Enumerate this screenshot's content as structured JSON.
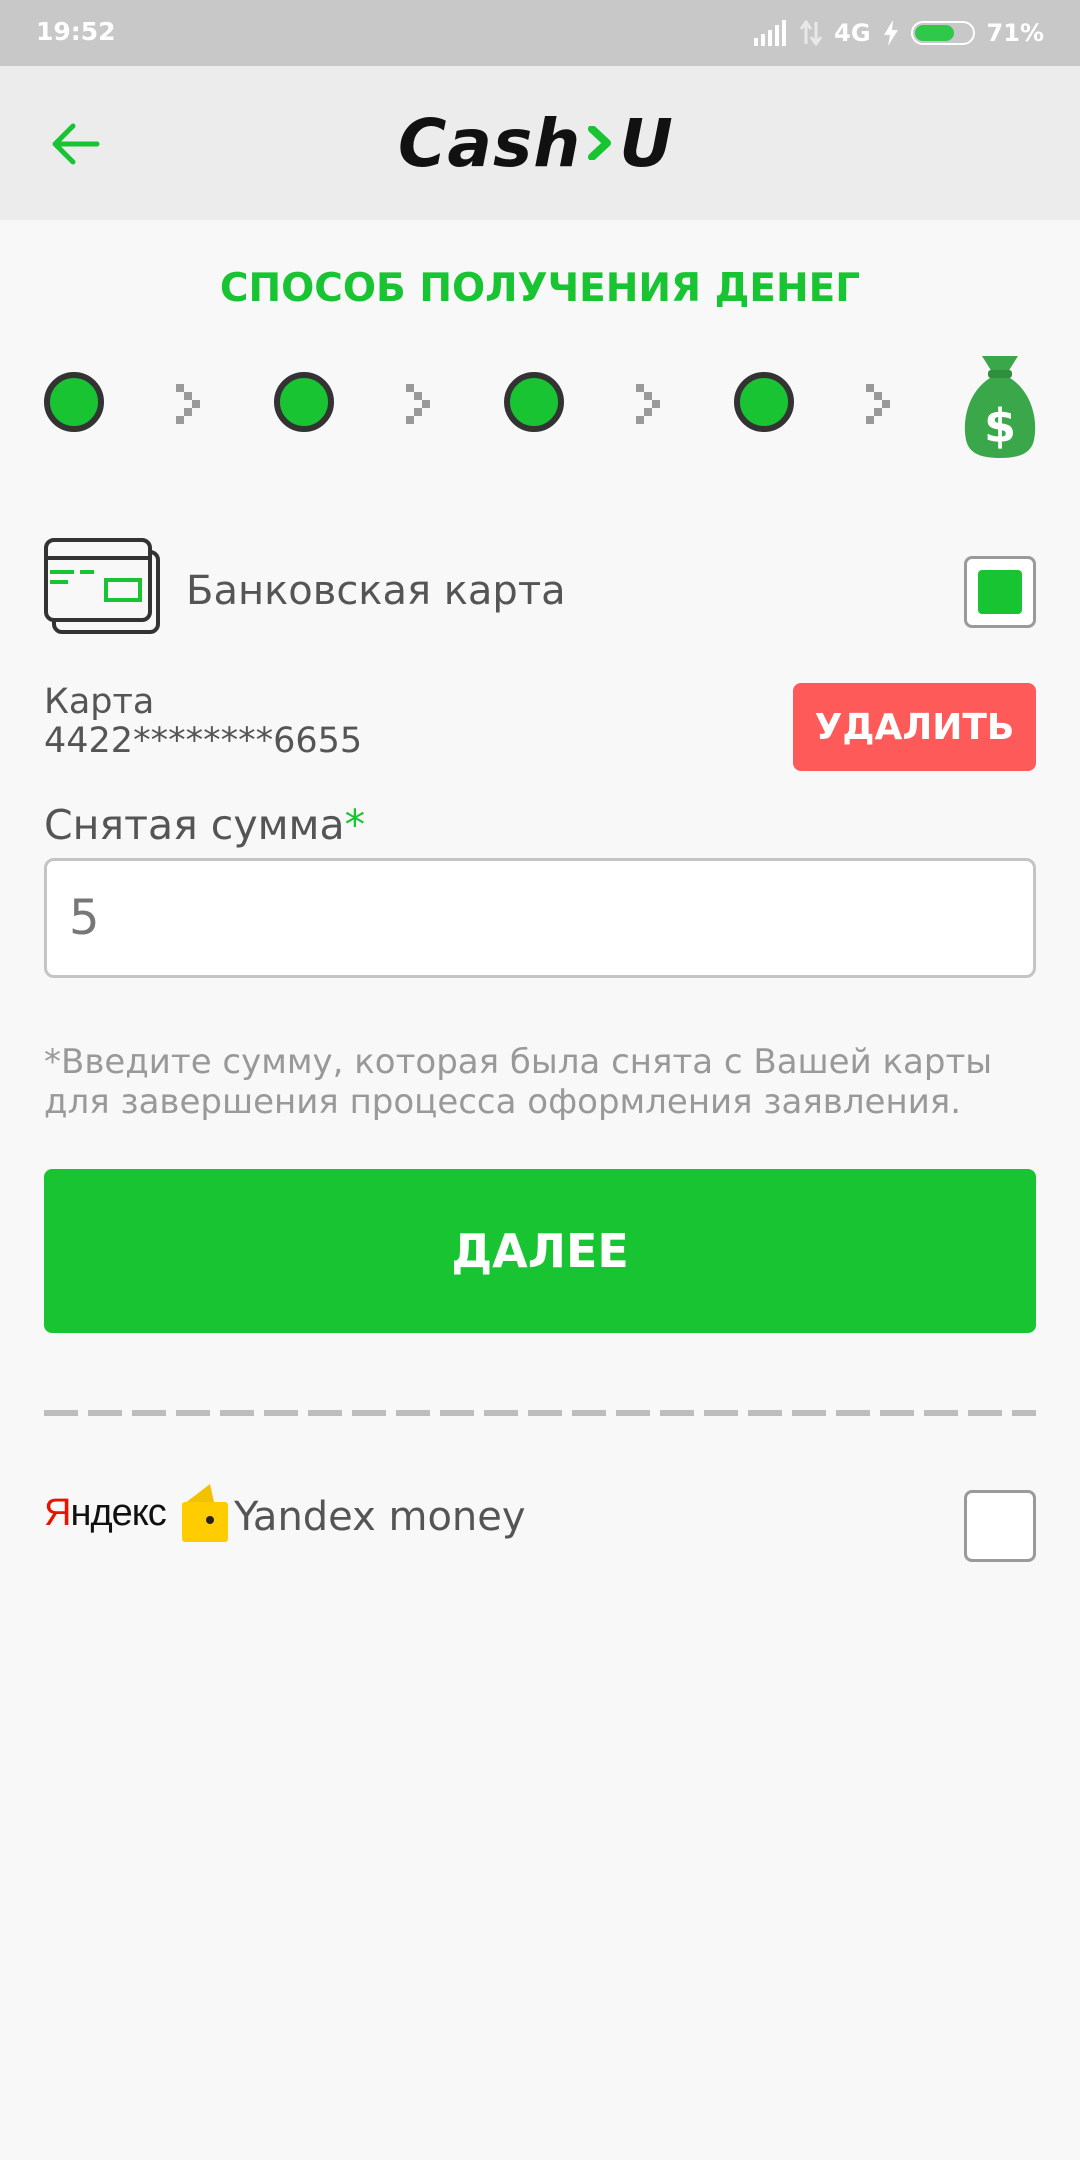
{
  "status_bar": {
    "time": "19:52",
    "network": "4G",
    "battery": "71%",
    "battery_level": 0.71
  },
  "app_bar": {
    "logo_left": "Cash",
    "logo_right": "U"
  },
  "title": "СПОСОБ ПОЛУЧЕНИЯ ДЕНЕГ",
  "stepper": {
    "total_steps": 5,
    "completed_steps": 4,
    "final_icon": "money-bag-icon"
  },
  "bank_card_option": {
    "label": "Банковская карта",
    "checked": true,
    "icon": "credit-card-icon"
  },
  "card_info": {
    "caption": "Карта",
    "number": "4422********6655",
    "delete_label": "УДАЛИТЬ"
  },
  "amount": {
    "label": "Снятая сумма",
    "required_mark": "*",
    "value": "5"
  },
  "hint": "*Введите сумму, которая была снята с Вашей карты для завершения процесса оформления заявления.",
  "next_label": "ДАЛЕЕ",
  "yandex_option": {
    "brand": "Яндекс",
    "label": "Yandex money",
    "checked": false,
    "icon": "yandex-wallet-icon"
  },
  "colors": {
    "accent": "#19c433",
    "danger": "#fe5a5a",
    "text": "#555555"
  }
}
